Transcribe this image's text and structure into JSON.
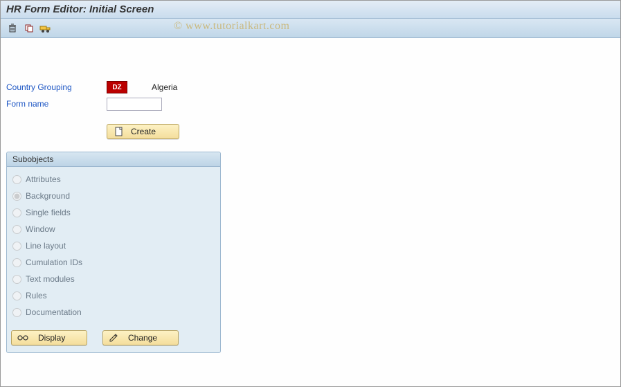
{
  "header": {
    "title": "HR Form Editor: Initial Screen"
  },
  "watermark": "© www.tutorialkart.com",
  "form": {
    "country_label": "Country Grouping",
    "country_code": "DZ",
    "country_name": "Algeria",
    "formname_label": "Form name"
  },
  "buttons": {
    "create": "Create",
    "display": "Display",
    "change": "Change"
  },
  "panel": {
    "title": "Subobjects",
    "options": [
      {
        "label": "Attributes",
        "selected": false
      },
      {
        "label": "Background",
        "selected": true
      },
      {
        "label": "Single fields",
        "selected": false
      },
      {
        "label": "Window",
        "selected": false
      },
      {
        "label": "Line layout",
        "selected": false
      },
      {
        "label": "Cumulation IDs",
        "selected": false
      },
      {
        "label": "Text modules",
        "selected": false
      },
      {
        "label": "Rules",
        "selected": false
      },
      {
        "label": "Documentation",
        "selected": false
      }
    ]
  }
}
